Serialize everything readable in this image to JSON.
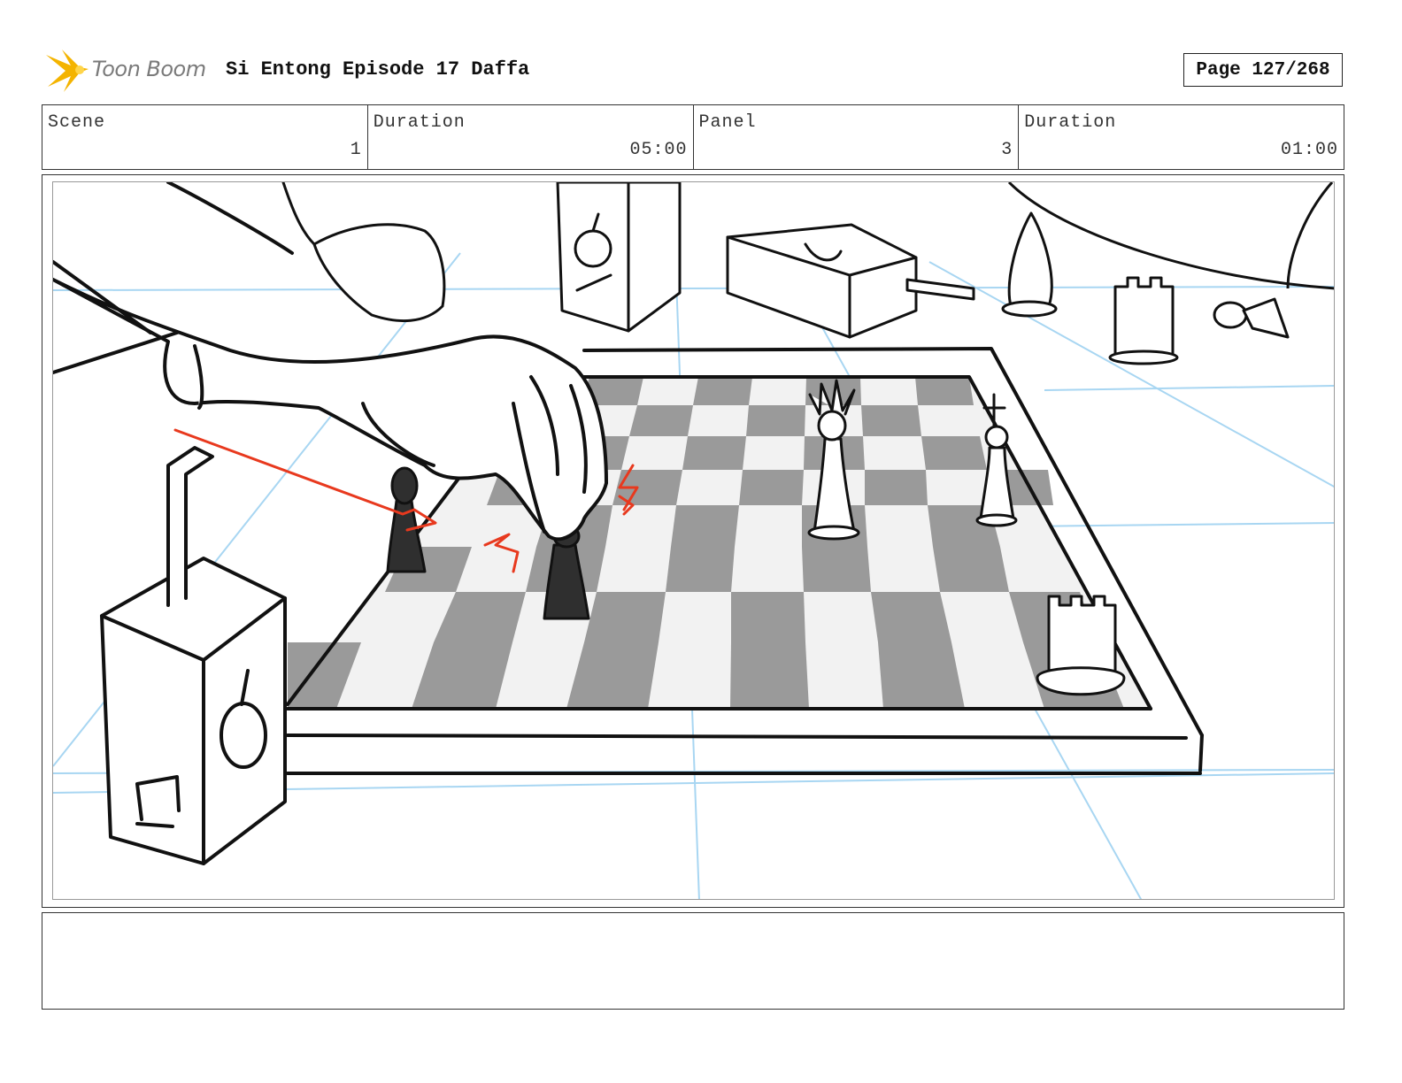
{
  "header": {
    "logo_text": "Toon Boom",
    "title": "Si Entong Episode 17 Daffa",
    "page": "Page 127/268"
  },
  "info": {
    "scene_label": "Scene",
    "scene_value": "1",
    "duration_label": "Duration",
    "duration_value": "05:00",
    "panel_label": "Panel",
    "panel_value": "3",
    "panel_duration_label": "Duration",
    "panel_duration_value": "01:00"
  },
  "panel": {
    "image": "storyboard-sketch-chessboard-hand-moving-pawn"
  },
  "notes": {
    "text": ""
  },
  "colors": {
    "guide_lines": "#a8d6f2",
    "action_marks": "#e8391e",
    "dark_square": "#9a9a9a",
    "light_square": "#f2f2f2",
    "logo_flash": "#f4b400"
  }
}
